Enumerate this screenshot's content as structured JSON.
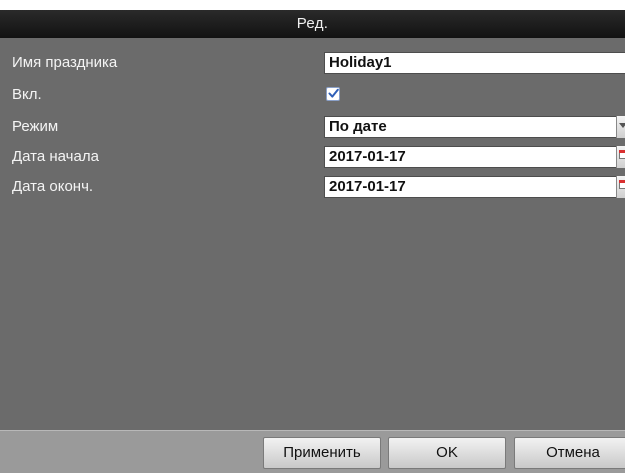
{
  "dialog": {
    "title": "Ред."
  },
  "form": {
    "holiday_name": {
      "label": "Имя праздника",
      "value": "Holiday1"
    },
    "enabled": {
      "label": "Вкл.",
      "checked": true
    },
    "mode": {
      "label": "Режим",
      "value": "По дате"
    },
    "start_date": {
      "label": "Дата начала",
      "value": "2017-01-17"
    },
    "end_date": {
      "label": "Дата оконч.",
      "value": "2017-01-17"
    }
  },
  "buttons": {
    "apply": "Применить",
    "ok": "OK",
    "cancel": "Отмена"
  },
  "icons": {
    "checkmark": "checkmark-icon",
    "dropdown": "chevron-down-icon",
    "calendar": "calendar-icon"
  }
}
